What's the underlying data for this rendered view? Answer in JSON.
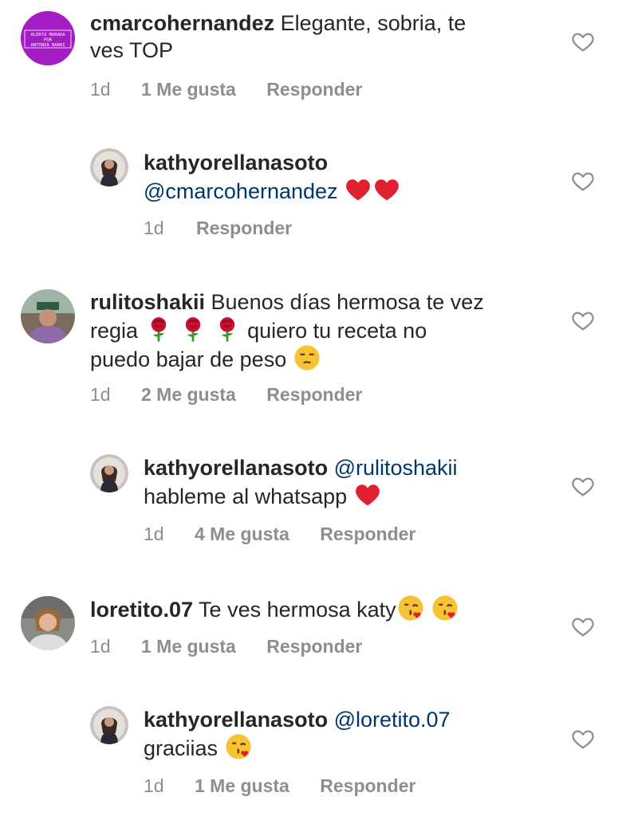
{
  "comments": [
    {
      "user": "cmarcohernandez",
      "text": " Elegante, sobria, te\nves TOP",
      "time": "1d",
      "likes": "1 Me gusta",
      "reply": "Responder",
      "avatar_text": [
        "ALERTA MORADA",
        "POR",
        "ANTONIA BARRI"
      ]
    },
    {
      "user": "kathyorellanasoto",
      "mention": "@cmarcohernandez",
      "time": "1d",
      "reply": "Responder",
      "emojis": [
        "red-heart",
        "red-heart"
      ]
    },
    {
      "user": "rulitoshakii",
      "text_1": " Buenos días hermosa te vez",
      "text_2": "regia",
      "text_3": " quiero tu receta no",
      "text_4": "puedo bajar de peso",
      "time": "1d",
      "likes": "2 Me gusta",
      "reply": "Responder",
      "emojis": [
        "rose",
        "rose",
        "rose",
        "unamused-face"
      ]
    },
    {
      "user": "kathyorellanasoto",
      "mention": "@rulitoshakii",
      "text": "hableme al whatsapp",
      "time": "1d",
      "likes": "4 Me gusta",
      "reply": "Responder",
      "emojis": [
        "red-heart"
      ]
    },
    {
      "user": "loretito.07",
      "text": " Te ves hermosa katy",
      "time": "1d",
      "likes": "1 Me gusta",
      "reply": "Responder",
      "emojis": [
        "kissing-face",
        "kissing-face"
      ]
    },
    {
      "user": "kathyorellanasoto",
      "mention": "@loretito.07",
      "text": "graciias",
      "time": "1d",
      "likes": "1 Me gusta",
      "reply": "Responder",
      "emojis": [
        "kissing-face"
      ]
    }
  ],
  "colors": {
    "text": "#262626",
    "muted": "#8e8e8e",
    "mention": "#00376b",
    "heart": "#e0245e"
  }
}
